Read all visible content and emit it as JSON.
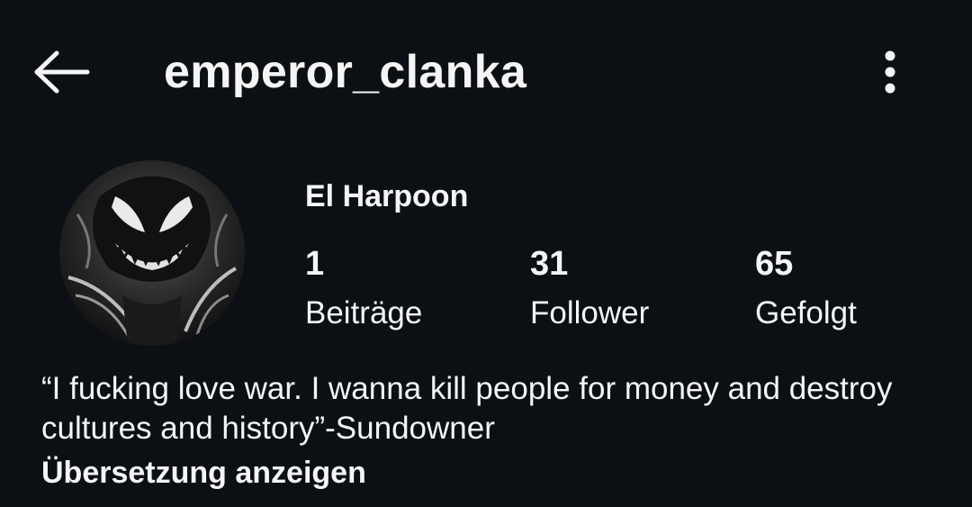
{
  "header": {
    "username": "emperor_clanka",
    "back_icon": "arrow-left-icon",
    "more_icon": "more-vertical-icon"
  },
  "profile": {
    "avatar_icon": "avatar-image",
    "display_name": "El Harpoon",
    "stats": {
      "posts": {
        "value": "1",
        "label": "Beiträge"
      },
      "followers": {
        "value": "31",
        "label": "Follower"
      },
      "following": {
        "value": "65",
        "label": "Gefolgt"
      }
    },
    "bio": "“I fucking love war. I wanna kill people for money and destroy cultures and history”-Sundowner",
    "translate_link": "Übersetzung anzeigen"
  },
  "colors": {
    "background": "#0c1014",
    "text": "#f5f5f5"
  }
}
